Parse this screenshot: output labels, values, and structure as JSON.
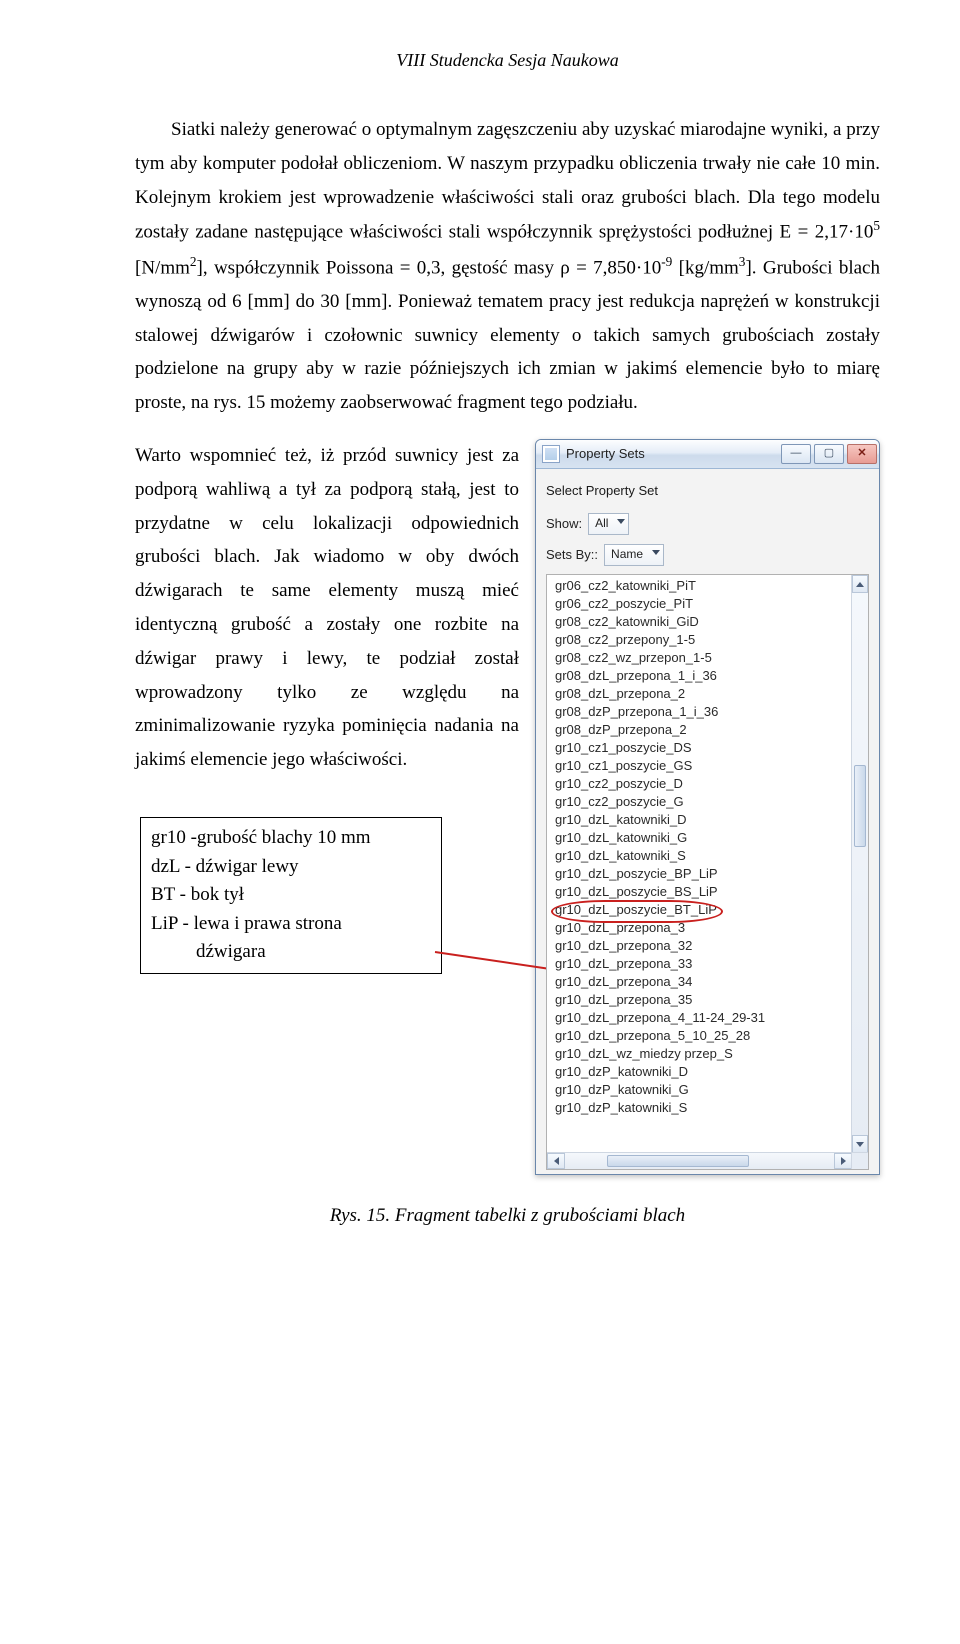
{
  "header": {
    "session_title": "VIII Studencka Sesja Naukowa"
  },
  "paragraph1": {
    "p1": "Siatki należy generować o optymalnym zagęszczeniu aby uzyskać miarodajne wyniki, a przy tym aby komputer podołał obliczeniom. W naszym przypadku obliczenia trwały nie całe 10 min. Kolejnym krokiem jest wprowadzenie właściwości stali oraz grubości blach. Dla tego modelu zostały zadane następujące właściwości stali współczynnik sprężystości podłużnej E = 2,17·10",
    "p1_sup": "5",
    "p1b": " [N/mm",
    "p1b_sup": "2",
    "p1c": "], współczynnik Poissona  = 0,3, gęstość masy ρ = 7,850·10",
    "p1c_sup": "-9",
    "p1d": " [kg/mm",
    "p1d_sup": "3",
    "p1e": "]. Grubości blach wynoszą od 6 [mm] do 30 [mm]. Ponieważ tematem pracy jest redukcja naprężeń w konstrukcji stalowej dźwigarów i czołownic suwnicy elementy o takich samych grubościach zostały podzielone na grupy aby w razie późniejszych ich zmian w jakimś elemencie było to miarę proste, na rys. 15 możemy zaobserwować fragment tego podziału."
  },
  "paragraph2": "Warto wspomnieć też, iż przód suwnicy jest za podporą wahliwą a tył za podporą stałą, jest to przydatne w celu lokalizacji odpowiednich grubości blach. Jak wiadomo w oby dwóch dźwigarach te same elementy muszą mieć identyczną grubość a zostały one rozbite na dźwigar prawy i lewy, te podział został wprowadzony tylko ze względu na zminimalizowanie ryzyka pominięcia nadania na jakimś elemencie jego właściwości.",
  "legend": {
    "l1": "gr10 -grubość blachy 10 mm",
    "l2": "dzL - dźwigar lewy",
    "l3": "BT - bok tył",
    "l4": "LiP - lewa i prawa strona",
    "l5_indent": "dźwigara"
  },
  "window": {
    "title": "Property Sets",
    "panel_title": "Select Property Set",
    "show_label": "Show:",
    "show_value": "All",
    "setsby_label": "Sets By::",
    "setsby_value": "Name",
    "items": [
      "gr06_cz2_katowniki_PiT",
      "gr06_cz2_poszycie_PiT",
      "gr08_cz2_katowniki_GiD",
      "gr08_cz2_przepony_1-5",
      "gr08_cz2_wz_przepon_1-5",
      "gr08_dzL_przepona_1_i_36",
      "gr08_dzL_przepona_2",
      "gr08_dzP_przepona_1_i_36",
      "gr08_dzP_przepona_2",
      "gr10_cz1_poszycie_DS",
      "gr10_cz1_poszycie_GS",
      "gr10_cz2_poszycie_D",
      "gr10_cz2_poszycie_G",
      "gr10_dzL_katowniki_D",
      "gr10_dzL_katowniki_G",
      "gr10_dzL_katowniki_S",
      "gr10_dzL_poszycie_BP_LiP",
      "gr10_dzL_poszycie_BS_LiP",
      "gr10_dzL_poszycie_BT_LiP",
      "gr10_dzL_przepona_3",
      "gr10_dzL_przepona_32",
      "gr10_dzL_przepona_33",
      "gr10_dzL_przepona_34",
      "gr10_dzL_przepona_35",
      "gr10_dzL_przepona_4_11-24_29-31",
      "gr10_dzL_przepona_5_10_25_28",
      "gr10_dzL_wz_miedzy przep_S",
      "gr10_dzP_katowniki_D",
      "gr10_dzP_katowniki_G",
      "gr10_dzP_katowniki_S"
    ],
    "highlighted_index": 18
  },
  "figure_caption": "Rys. 15. Fragment tabelki z grubościami blach"
}
